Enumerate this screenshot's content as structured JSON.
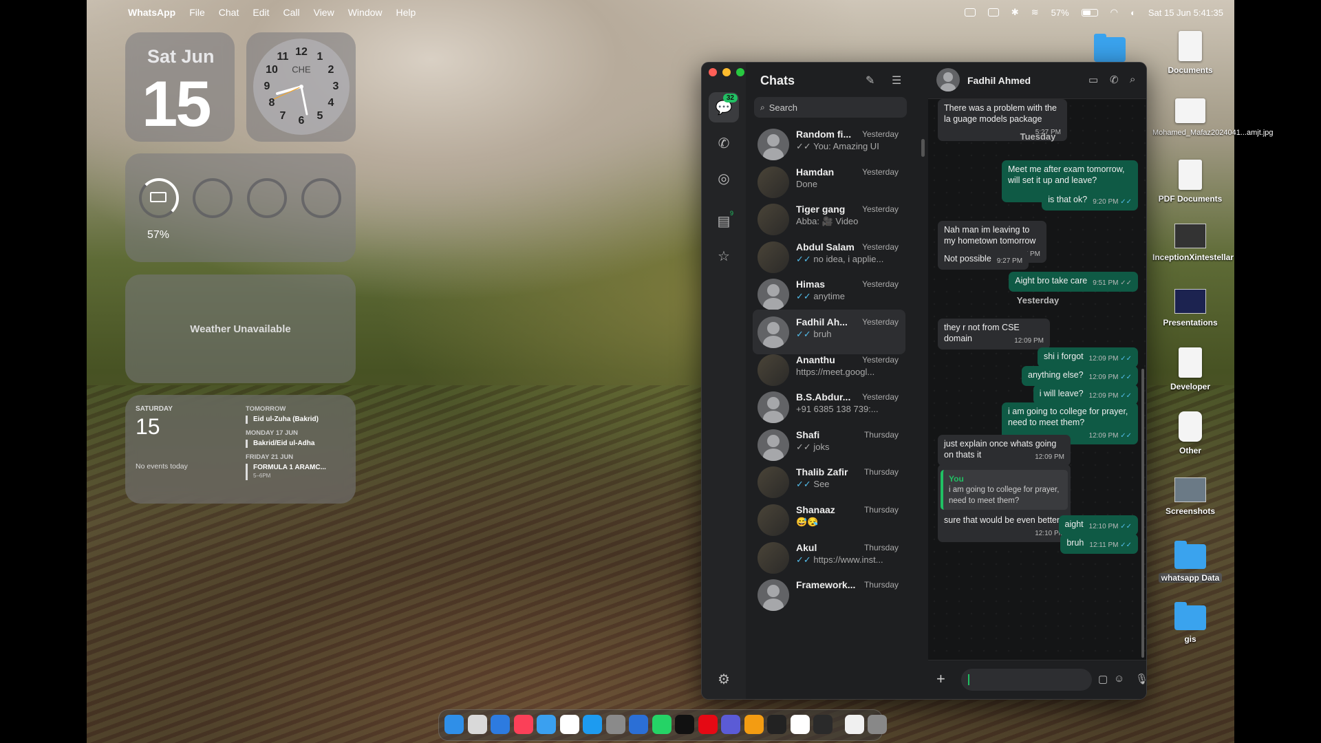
{
  "menubar": {
    "apple_glyph": "",
    "app": "WhatsApp",
    "items": [
      "File",
      "Chat",
      "Edit",
      "Call",
      "View",
      "Window",
      "Help"
    ],
    "battery": "57%",
    "datetime": "Sat 15 Jun  5:41:35"
  },
  "widgets": {
    "date": {
      "dow": "Sat Jun",
      "day": "15"
    },
    "clock": {
      "numbers": [
        "12",
        "1",
        "2",
        "3",
        "4",
        "5",
        "6",
        "7",
        "8",
        "9",
        "10",
        "11"
      ],
      "city": "CHE"
    },
    "battery": {
      "percent": "57%"
    },
    "weather": {
      "text": "Weather Unavailable"
    },
    "calendar": {
      "weekday": "SATURDAY",
      "day": "15",
      "no_events": "No events today",
      "groups": [
        {
          "heading": "TOMORROW",
          "event": "Eid ul-Zuha (Bakrid)",
          "time": ""
        },
        {
          "heading": "MONDAY 17 JUN",
          "event": "Bakrid/Eid ul-Adha",
          "time": ""
        },
        {
          "heading": "FRIDAY 21 JUN",
          "event": "FORMULA 1 ARAMC...",
          "time": "5–6PM"
        }
      ]
    }
  },
  "desktop_icons": [
    {
      "label": "Documents",
      "type": "doc"
    },
    {
      "label": "Mohamed_Mafaz2024041...amjt.jpg",
      "type": "thumb"
    },
    {
      "label": "PDF Documents",
      "type": "doc"
    },
    {
      "label": "InceptionXintestellar",
      "type": "thumb"
    },
    {
      "label": "Presentations",
      "type": "thumb"
    },
    {
      "label": "Developer",
      "type": "doc"
    },
    {
      "label": "Other",
      "type": "doc"
    },
    {
      "label": "Screenshots",
      "type": "thumb"
    },
    {
      "label": "whatsapp Data",
      "type": "folder"
    },
    {
      "label": "gis",
      "type": "folder"
    }
  ],
  "whatsapp": {
    "rail": {
      "chats_badge": "32",
      "channels_badge": "9"
    },
    "list_title": "Chats",
    "search_placeholder": "Search",
    "chats": [
      {
        "name": "Random fi...",
        "time": "Yesterday",
        "preview": "You: Amazing UI",
        "tick": "grey",
        "avatar": "person"
      },
      {
        "name": "Hamdan",
        "time": "Yesterday",
        "preview": "Done",
        "tick": "",
        "avatar": "photo"
      },
      {
        "name": "Tiger gang",
        "time": "Yesterday",
        "preview": "Abba: 🎥 Video",
        "tick": "",
        "avatar": "photo"
      },
      {
        "name": "Abdul Salam",
        "time": "Yesterday",
        "preview": "no idea, i applie...",
        "tick": "blue",
        "avatar": "photo"
      },
      {
        "name": "Himas",
        "time": "Yesterday",
        "preview": "anytime",
        "tick": "blue",
        "avatar": "person"
      },
      {
        "name": "Fadhil Ah...",
        "time": "Yesterday",
        "preview": "bruh",
        "tick": "blue",
        "avatar": "person"
      },
      {
        "name": "Ananthu",
        "time": "Yesterday",
        "preview": "https://meet.googl...",
        "tick": "",
        "avatar": "photo"
      },
      {
        "name": "B.S.Abdur...",
        "time": "Yesterday",
        "preview": "+91 6385 138 739:...",
        "tick": "",
        "avatar": "person"
      },
      {
        "name": "Shafi",
        "time": "Thursday",
        "preview": "joks",
        "tick": "grey",
        "avatar": "person"
      },
      {
        "name": "Thalib Zafir",
        "time": "Thursday",
        "preview": "See",
        "tick": "blue",
        "avatar": "photo"
      },
      {
        "name": "Shanaaz",
        "time": "Thursday",
        "preview": "😅😪",
        "tick": "",
        "avatar": "photo"
      },
      {
        "name": "Akul",
        "time": "Thursday",
        "preview": "https://www.inst...",
        "tick": "blue",
        "avatar": "photo"
      },
      {
        "name": "Framework...",
        "time": "Thursday",
        "preview": "",
        "tick": "",
        "avatar": "person"
      }
    ],
    "conversation": {
      "contact": "Fadhil Ahmed",
      "messages": [
        {
          "dir": "in",
          "text": "There was a problem with the la guage models package",
          "time": "5:27 PM"
        },
        {
          "dir": "day",
          "text": "Tuesday"
        },
        {
          "dir": "out",
          "text": "Meet me after exam tomorrow, will set it up and leave?",
          "time": "9:20 PM"
        },
        {
          "dir": "out",
          "text": "is that ok?",
          "time": "9:20 PM"
        },
        {
          "dir": "in",
          "text": "Nah man im leaving to my hometown tomorrow",
          "time": "9:27 PM"
        },
        {
          "dir": "in",
          "text": "Not possible",
          "time": "9:27 PM"
        },
        {
          "dir": "out",
          "text": "Aight bro take care",
          "time": "9:51 PM"
        },
        {
          "dir": "day",
          "text": "Yesterday"
        },
        {
          "dir": "in",
          "text": "they r not from CSE domain",
          "time": "12:09 PM"
        },
        {
          "dir": "out",
          "text": "shi i forgot",
          "time": "12:09 PM"
        },
        {
          "dir": "out",
          "text": "anything else?",
          "time": "12:09 PM"
        },
        {
          "dir": "out",
          "text": "i will leave?",
          "time": "12:09 PM"
        },
        {
          "dir": "out",
          "text": "i am going to college for prayer, need to meet them?",
          "time": "12:09 PM"
        },
        {
          "dir": "in",
          "text": "just explain once whats going on thats it",
          "time": "12:09 PM"
        },
        {
          "dir": "in",
          "quote_name": "You",
          "quote_text": "i am going to college for prayer, need to meet them?",
          "text": "sure that would be even better",
          "time": "12:10 PM"
        },
        {
          "dir": "out",
          "text": "aight",
          "time": "12:10 PM"
        },
        {
          "dir": "out",
          "text": "bruh",
          "time": "12:11 PM"
        }
      ]
    }
  },
  "colors": {
    "accent": "#21c063",
    "out_bubble": "#0f5a45",
    "in_bubble": "#2c2d30",
    "read_tick": "#53bdeb"
  }
}
